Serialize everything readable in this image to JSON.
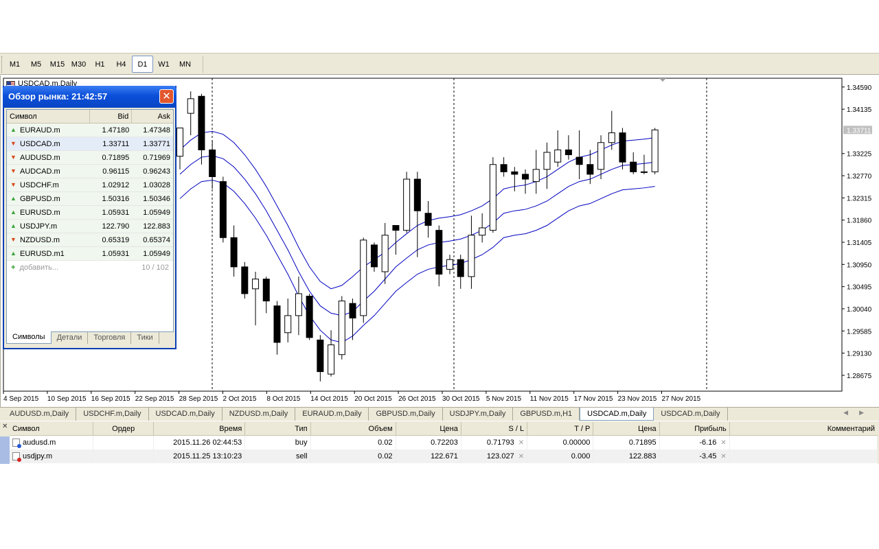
{
  "timeframes": [
    "M1",
    "M5",
    "M15",
    "M30",
    "H1",
    "H4",
    "D1",
    "W1",
    "MN"
  ],
  "active_timeframe": "D1",
  "chart": {
    "title": "USDCAD.m,Daily",
    "current_price_label": "1.33711",
    "price_labels": [
      "1.34590",
      "1.34135",
      "1.33225",
      "1.32770",
      "1.32315",
      "1.31860",
      "1.31405",
      "1.30950",
      "1.30495",
      "1.30040",
      "1.29585",
      "1.29130",
      "1.28675"
    ],
    "date_labels": [
      "4 Sep 2015",
      "10 Sep 2015",
      "16 Sep 2015",
      "22 Sep 2015",
      "28 Sep 2015",
      "2 Oct 2015",
      "8 Oct 2015",
      "14 Oct 2015",
      "20 Oct 2015",
      "26 Oct 2015",
      "30 Oct 2015",
      "5 Nov 2015",
      "11 Nov 2015",
      "17 Nov 2015",
      "23 Nov 2015",
      "27 Nov 2015"
    ],
    "colors": {
      "bull": "#ffffff",
      "bear": "#000000",
      "envelope": "#0000c0",
      "grid": "#c0c0c0",
      "period_sep": "#000000"
    }
  },
  "chart_data": {
    "type": "candlestick",
    "symbol": "USDCAD.m",
    "timeframe": "Daily",
    "ylim": [
      1.2835,
      1.3477
    ],
    "candles": [
      {
        "o": 1.3317,
        "h": 1.3345,
        "l": 1.329,
        "c": 1.3375
      },
      {
        "o": 1.3405,
        "h": 1.345,
        "l": 1.336,
        "c": 1.3435
      },
      {
        "o": 1.344,
        "h": 1.3445,
        "l": 1.33,
        "c": 1.333
      },
      {
        "o": 1.333,
        "h": 1.335,
        "l": 1.325,
        "c": 1.3275
      },
      {
        "o": 1.3265,
        "h": 1.3275,
        "l": 1.314,
        "c": 1.315
      },
      {
        "o": 1.315,
        "h": 1.3175,
        "l": 1.307,
        "c": 1.309
      },
      {
        "o": 1.309,
        "h": 1.31,
        "l": 1.3025,
        "c": 1.3035
      },
      {
        "o": 1.3045,
        "h": 1.308,
        "l": 1.297,
        "c": 1.3065
      },
      {
        "o": 1.3065,
        "h": 1.307,
        "l": 1.2995,
        "c": 1.302
      },
      {
        "o": 1.301,
        "h": 1.302,
        "l": 1.291,
        "c": 1.2935
      },
      {
        "o": 1.2955,
        "h": 1.3025,
        "l": 1.2935,
        "c": 1.299
      },
      {
        "o": 1.299,
        "h": 1.307,
        "l": 1.295,
        "c": 1.3035
      },
      {
        "o": 1.303,
        "h": 1.3035,
        "l": 1.294,
        "c": 1.2945
      },
      {
        "o": 1.294,
        "h": 1.295,
        "l": 1.2855,
        "c": 1.2875
      },
      {
        "o": 1.287,
        "h": 1.296,
        "l": 1.2865,
        "c": 1.293
      },
      {
        "o": 1.291,
        "h": 1.303,
        "l": 1.29,
        "c": 1.302
      },
      {
        "o": 1.3015,
        "h": 1.3025,
        "l": 1.294,
        "c": 1.2985
      },
      {
        "o": 1.299,
        "h": 1.315,
        "l": 1.2975,
        "c": 1.3145
      },
      {
        "o": 1.3135,
        "h": 1.314,
        "l": 1.308,
        "c": 1.309
      },
      {
        "o": 1.308,
        "h": 1.318,
        "l": 1.3055,
        "c": 1.3155
      },
      {
        "o": 1.3175,
        "h": 1.3175,
        "l": 1.3115,
        "c": 1.3165
      },
      {
        "o": 1.3165,
        "h": 1.3285,
        "l": 1.316,
        "c": 1.327
      },
      {
        "o": 1.327,
        "h": 1.3285,
        "l": 1.311,
        "c": 1.3205
      },
      {
        "o": 1.32,
        "h": 1.3225,
        "l": 1.315,
        "c": 1.3175
      },
      {
        "o": 1.3165,
        "h": 1.3175,
        "l": 1.305,
        "c": 1.3075
      },
      {
        "o": 1.3085,
        "h": 1.3115,
        "l": 1.3075,
        "c": 1.3105
      },
      {
        "o": 1.3105,
        "h": 1.3115,
        "l": 1.3045,
        "c": 1.307
      },
      {
        "o": 1.307,
        "h": 1.3195,
        "l": 1.3045,
        "c": 1.3155
      },
      {
        "o": 1.3155,
        "h": 1.32,
        "l": 1.314,
        "c": 1.317
      },
      {
        "o": 1.3165,
        "h": 1.3315,
        "l": 1.316,
        "c": 1.33
      },
      {
        "o": 1.33,
        "h": 1.3315,
        "l": 1.3275,
        "c": 1.3285
      },
      {
        "o": 1.3285,
        "h": 1.3295,
        "l": 1.3245,
        "c": 1.328
      },
      {
        "o": 1.328,
        "h": 1.329,
        "l": 1.324,
        "c": 1.327
      },
      {
        "o": 1.3265,
        "h": 1.333,
        "l": 1.324,
        "c": 1.329
      },
      {
        "o": 1.329,
        "h": 1.3345,
        "l": 1.325,
        "c": 1.3325
      },
      {
        "o": 1.3305,
        "h": 1.337,
        "l": 1.3295,
        "c": 1.333
      },
      {
        "o": 1.333,
        "h": 1.336,
        "l": 1.331,
        "c": 1.332
      },
      {
        "o": 1.3315,
        "h": 1.337,
        "l": 1.327,
        "c": 1.33
      },
      {
        "o": 1.33,
        "h": 1.333,
        "l": 1.326,
        "c": 1.328
      },
      {
        "o": 1.329,
        "h": 1.336,
        "l": 1.327,
        "c": 1.3345
      },
      {
        "o": 1.3345,
        "h": 1.341,
        "l": 1.333,
        "c": 1.3365
      },
      {
        "o": 1.3365,
        "h": 1.3375,
        "l": 1.329,
        "c": 1.3305
      },
      {
        "o": 1.3305,
        "h": 1.3325,
        "l": 1.328,
        "c": 1.3285
      },
      {
        "o": 1.3285,
        "h": 1.332,
        "l": 1.328,
        "c": 1.3285
      },
      {
        "o": 1.3285,
        "h": 1.3375,
        "l": 1.328,
        "c": 1.3371
      }
    ],
    "envelopes": {
      "upper": [
        1.333,
        1.335,
        1.3365,
        1.3368,
        1.3362,
        1.3345,
        1.332,
        1.329,
        1.3255,
        1.3215,
        1.3175,
        1.313,
        1.309,
        1.306,
        1.3045,
        1.3052,
        1.307,
        1.309,
        1.3105,
        1.312,
        1.314,
        1.3158,
        1.3175,
        1.3185,
        1.319,
        1.3193,
        1.3197,
        1.3205,
        1.3215,
        1.323,
        1.325,
        1.3255,
        1.3258,
        1.3265,
        1.3275,
        1.329,
        1.3305,
        1.3315,
        1.332,
        1.333,
        1.334,
        1.3348,
        1.335,
        1.3352,
        1.3355
      ],
      "middle": [
        1.328,
        1.33,
        1.3315,
        1.3318,
        1.3312,
        1.3295,
        1.327,
        1.324,
        1.3205,
        1.3165,
        1.3125,
        1.308,
        1.304,
        1.301,
        1.2995,
        1.299,
        1.2998,
        1.302,
        1.304,
        1.3065,
        1.309,
        1.3108,
        1.3125,
        1.3135,
        1.314,
        1.3143,
        1.3147,
        1.3155,
        1.3165,
        1.318,
        1.32,
        1.3205,
        1.3208,
        1.3215,
        1.3225,
        1.324,
        1.3255,
        1.3265,
        1.327,
        1.328,
        1.329,
        1.3298,
        1.33,
        1.3302,
        1.3305
      ],
      "lower": [
        1.323,
        1.325,
        1.3265,
        1.3268,
        1.3262,
        1.3245,
        1.322,
        1.319,
        1.3155,
        1.3115,
        1.3075,
        1.303,
        1.299,
        1.296,
        1.294,
        1.2935,
        1.2948,
        1.297,
        1.299,
        1.3015,
        1.304,
        1.3058,
        1.3075,
        1.3085,
        1.309,
        1.3093,
        1.3097,
        1.3105,
        1.3115,
        1.313,
        1.315,
        1.3155,
        1.3158,
        1.3165,
        1.3175,
        1.319,
        1.3205,
        1.3215,
        1.322,
        1.323,
        1.324,
        1.3248,
        1.325,
        1.3252,
        1.3255
      ]
    }
  },
  "market_watch": {
    "title": "Обзор рынка: 21:42:57",
    "columns": {
      "symbol": "Символ",
      "bid": "Bid",
      "ask": "Ask"
    },
    "rows": [
      {
        "symbol": "EURAUD.m",
        "bid": "1.47180",
        "ask": "1.47348",
        "dir": "up"
      },
      {
        "symbol": "USDCAD.m",
        "bid": "1.33711",
        "ask": "1.33771",
        "dir": "down"
      },
      {
        "symbol": "AUDUSD.m",
        "bid": "0.71895",
        "ask": "0.71969",
        "dir": "down"
      },
      {
        "symbol": "AUDCAD.m",
        "bid": "0.96115",
        "ask": "0.96243",
        "dir": "down"
      },
      {
        "symbol": "USDCHF.m",
        "bid": "1.02912",
        "ask": "1.03028",
        "dir": "down"
      },
      {
        "symbol": "GBPUSD.m",
        "bid": "1.50316",
        "ask": "1.50346",
        "dir": "up"
      },
      {
        "symbol": "EURUSD.m",
        "bid": "1.05931",
        "ask": "1.05949",
        "dir": "up"
      },
      {
        "symbol": "USDJPY.m",
        "bid": "122.790",
        "ask": "122.883",
        "dir": "up"
      },
      {
        "symbol": "NZDUSD.m",
        "bid": "0.65319",
        "ask": "0.65374",
        "dir": "down"
      },
      {
        "symbol": "EURUSD.m1",
        "bid": "1.05931",
        "ask": "1.05949",
        "dir": "up"
      }
    ],
    "add_label": "добавить...",
    "count_label": "10 / 102",
    "tabs": [
      "Символы",
      "Детали",
      "Торговля",
      "Тики"
    ]
  },
  "chart_tabs": [
    "AUDUSD.m,Daily",
    "USDCHF.m,Daily",
    "USDCAD.m,Daily",
    "NZDUSD.m,Daily",
    "EURAUD.m,Daily",
    "GBPUSD.m,Daily",
    "USDJPY.m,Daily",
    "GBPUSD.m,H1",
    "USDCAD.m,Daily",
    "USDCAD.m,Daily"
  ],
  "active_chart_tab": 8,
  "terminal": {
    "columns": {
      "symbol": "Символ",
      "order": "Ордер",
      "time": "Время",
      "type": "Тип",
      "volume": "Объем",
      "price": "Цена",
      "sl": "S / L",
      "tp": "T / P",
      "current": "Цена",
      "profit": "Прибыль",
      "comment": "Комментарий"
    },
    "rows": [
      {
        "symbol": "audusd.m",
        "order": "",
        "time": "2015.11.26 02:44:53",
        "type": "buy",
        "volume": "0.02",
        "price": "0.72203",
        "sl": "0.71793",
        "tp": "0.00000",
        "current": "0.71895",
        "profit": "-6.16",
        "comment": ""
      },
      {
        "symbol": "usdjpy.m",
        "order": "",
        "time": "2015.11.25 13:10:23",
        "type": "sell",
        "volume": "0.02",
        "price": "122.671",
        "sl": "123.027",
        "tp": "0.000",
        "current": "122.883",
        "profit": "-3.45",
        "comment": ""
      }
    ]
  }
}
